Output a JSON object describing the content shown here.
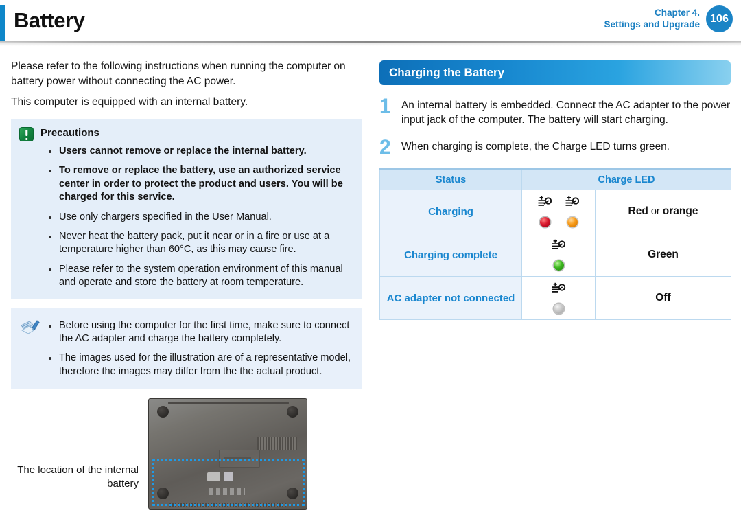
{
  "header": {
    "title": "Battery",
    "chapter_line1": "Chapter 4.",
    "chapter_line2": "Settings and Upgrade",
    "page_number": "106",
    "accent_color": "#0f87c9",
    "chapter_color": "#1a7fc1"
  },
  "left": {
    "intro": [
      "Please refer to the following instructions when running the computer on battery power without connecting the AC power.",
      "This computer is equipped with an internal battery."
    ],
    "precautions": {
      "title": "Precautions",
      "icon": "exclamation-icon",
      "icon_color": "#12823f",
      "items": [
        {
          "text": "Users cannot remove or replace the internal battery.",
          "bold": true
        },
        {
          "text": "To remove or replace the battery, use an authorized service center in order to protect the product and users. You will be charged for this service.",
          "bold": true
        },
        {
          "text": "Use only chargers specified in the User Manual.",
          "bold": false
        },
        {
          "text": "Never heat the battery pack, put it near or in a fire or use at a temperature higher than 60°C, as this may cause fire.",
          "bold": false
        },
        {
          "text": "Please refer to the system operation environment of this manual and operate and store the battery at room temperature.",
          "bold": false
        }
      ]
    },
    "note": {
      "icon": "note-pen-icon",
      "items": [
        {
          "text": "Before using the computer for the first time, make sure to connect the AC adapter and charge the battery completely."
        },
        {
          "text": "The images used for the illustration are of a representative model, therefore the images may differ from the the actual product."
        }
      ]
    },
    "illustration": {
      "caption": "The location of the internal battery",
      "highlight_color": "#1e9ae6",
      "alt": "laptop-bottom-photo"
    }
  },
  "right": {
    "section_title": "Charging the Battery",
    "section_bar_color": "#1787cf",
    "steps": [
      {
        "num": "1",
        "text": "An internal battery is embedded. Connect the AC adapter to the power input jack of the computer. The battery will start charging."
      },
      {
        "num": "2",
        "text": "When charging is complete, the Charge LED turns green."
      }
    ],
    "table": {
      "headers": [
        "Status",
        "Charge LED"
      ],
      "rows": [
        {
          "status": "Charging",
          "leds": [
            {
              "icon": "charge-led-icon",
              "state": "red"
            },
            {
              "icon": "charge-led-icon",
              "state": "orange"
            }
          ],
          "color_primary": "Red",
          "color_separator": " or ",
          "color_secondary": "orange"
        },
        {
          "status": "Charging complete",
          "leds": [
            {
              "icon": "charge-led-icon",
              "state": "green"
            }
          ],
          "color_primary": "Green",
          "color_separator": "",
          "color_secondary": ""
        },
        {
          "status": "AC adapter not connected",
          "leds": [
            {
              "icon": "charge-led-icon",
              "state": "off"
            }
          ],
          "color_primary": "Off",
          "color_separator": "",
          "color_secondary": ""
        }
      ]
    }
  }
}
